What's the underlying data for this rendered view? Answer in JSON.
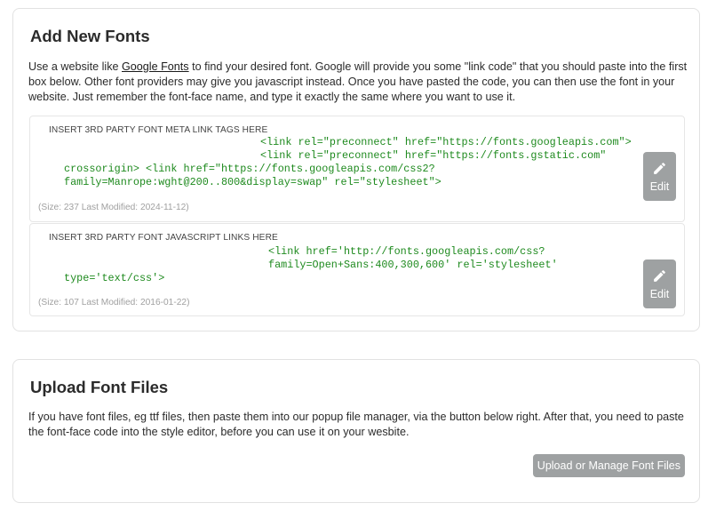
{
  "add_fonts": {
    "title": "Add New Fonts",
    "desc_before": "Use a website like ",
    "desc_link": "Google Fonts",
    "desc_after": " to find your desired font. Google will provide you some \"link code\" that you should paste into the first box below. Other font providers may give you javascript instead. Once you have pasted the code, you can then use the font in your website. Just remember the font-face name, and type it exactly the same where you want to use it.",
    "boxes": [
      {
        "label": "INSERT 3RD PARTY FONT META LINK TAGS HERE",
        "code_lines": [
          "<link rel=\"preconnect\" href=\"https://fonts.googleapis.com\">",
          "<link rel=\"preconnect\" href=\"https://fonts.gstatic.com\"",
          "crossorigin> <link href=\"https://fonts.googleapis.com/css2?",
          "family=Manrope:wght@200..800&display=swap\" rel=\"stylesheet\">"
        ],
        "meta": "(Size: 237 Last Modified: 2024-11-12)",
        "edit_label": "Edit"
      },
      {
        "label": "INSERT 3RD PARTY FONT JAVASCRIPT LINKS HERE",
        "code_lines": [
          "<link href='http://fonts.googleapis.com/css?",
          "family=Open+Sans:400,300,600' rel='stylesheet'",
          "type='text/css'>"
        ],
        "meta": "(Size: 107 Last Modified: 2016-01-22)",
        "edit_label": "Edit"
      }
    ]
  },
  "upload": {
    "title": "Upload Font Files",
    "desc": "If you have font files, eg ttf files, then paste them into our popup file manager, via the button below right. After that, you need to paste the font-face code into the style editor, before you can use it on your wesbite.",
    "button_label": "Upload or Manage Font Files"
  },
  "icons": {
    "edit": "pencil-icon"
  },
  "colors": {
    "code": "#1e8a1e",
    "button": "#9ea1a2"
  }
}
